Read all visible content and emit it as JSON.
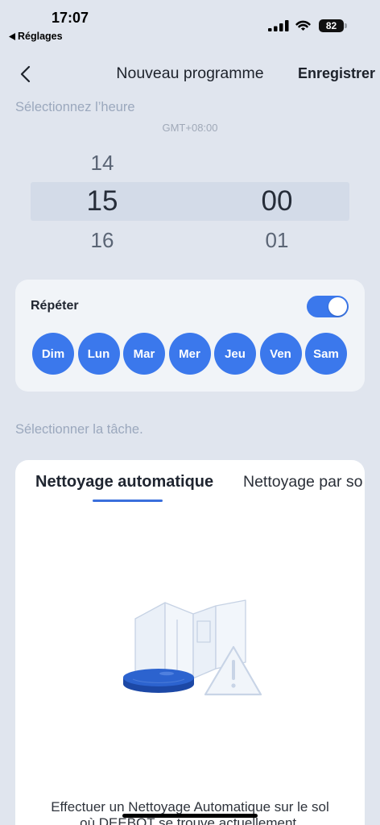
{
  "status_bar": {
    "time": "17:07",
    "back_app": "Réglages",
    "back_icon": "back-arrow-icon",
    "battery": "82",
    "icons": [
      "cellular-signal-icon",
      "wifi-icon",
      "battery-icon"
    ]
  },
  "nav": {
    "back_icon": "chevron-left-icon",
    "title": "Nouveau programme",
    "save_label": "Enregistrer"
  },
  "time_selection": {
    "label": "Sélectionnez l’heure",
    "timezone": "GMT+08:00"
  },
  "time_picker": {
    "hours": {
      "previous": "14",
      "selected": "15",
      "next": "16"
    },
    "minutes": {
      "selected": "00",
      "next": "01"
    }
  },
  "repeat": {
    "label": "Répéter",
    "enabled": true,
    "days": [
      {
        "label": "Dim",
        "selected": true
      },
      {
        "label": "Lun",
        "selected": true
      },
      {
        "label": "Mar",
        "selected": true
      },
      {
        "label": "Mer",
        "selected": true
      },
      {
        "label": "Jeu",
        "selected": true
      },
      {
        "label": "Ven",
        "selected": true
      },
      {
        "label": "Sam",
        "selected": true
      }
    ]
  },
  "task_selection": {
    "label": "Sélectionner la tâche."
  },
  "task_tabs": [
    {
      "label": "Nettoyage automatique",
      "active": true
    },
    {
      "label": "Nettoyage par so",
      "active": false
    }
  ],
  "task_content": {
    "illustration_icon": "robot-vacuum-warning-icon",
    "description_line1": "Effectuer un Nettoyage Automatique sur le sol",
    "description_line2": "où DEEBOT se trouve actuellement."
  },
  "colors": {
    "background": "#e0e5ee",
    "accent": "#3b78ec",
    "muted_text": "#9ba8bd",
    "card": "#f1f4f8"
  }
}
